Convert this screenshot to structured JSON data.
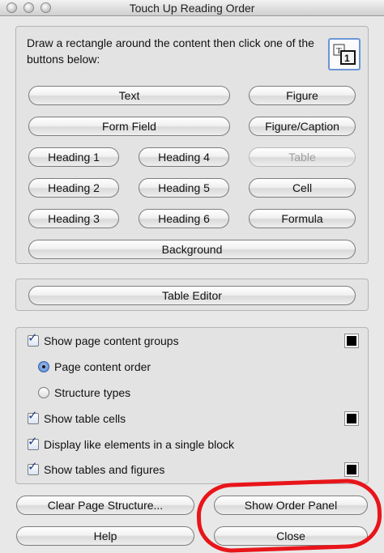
{
  "window": {
    "title": "Touch Up Reading Order"
  },
  "instructions": "Draw a rectangle around the content then click one of the buttons below:",
  "tag_buttons": {
    "text": "Text",
    "figure": "Figure",
    "form_field": "Form Field",
    "figure_caption": "Figure/Caption",
    "heading1": "Heading 1",
    "heading4": "Heading 4",
    "table": "Table",
    "heading2": "Heading 2",
    "heading5": "Heading 5",
    "cell": "Cell",
    "heading3": "Heading 3",
    "heading6": "Heading 6",
    "formula": "Formula",
    "background": "Background"
  },
  "table_editor": "Table Editor",
  "options": {
    "show_page_content_groups": {
      "label": "Show page content groups",
      "checked": true
    },
    "page_content_order": {
      "label": "Page content order",
      "selected": true
    },
    "structure_types": {
      "label": "Structure types",
      "selected": false
    },
    "show_table_cells": {
      "label": "Show table cells",
      "checked": true
    },
    "display_like_elements": {
      "label": "Display like elements in a single block",
      "checked": true
    },
    "show_tables_and_figures": {
      "label": "Show tables and figures",
      "checked": true
    },
    "swatch_color": "#000000"
  },
  "bottom_buttons": {
    "clear_page_structure": "Clear Page Structure...",
    "show_order_panel": "Show Order Panel",
    "help": "Help",
    "close": "Close"
  },
  "annotation_color": "#e8151a"
}
